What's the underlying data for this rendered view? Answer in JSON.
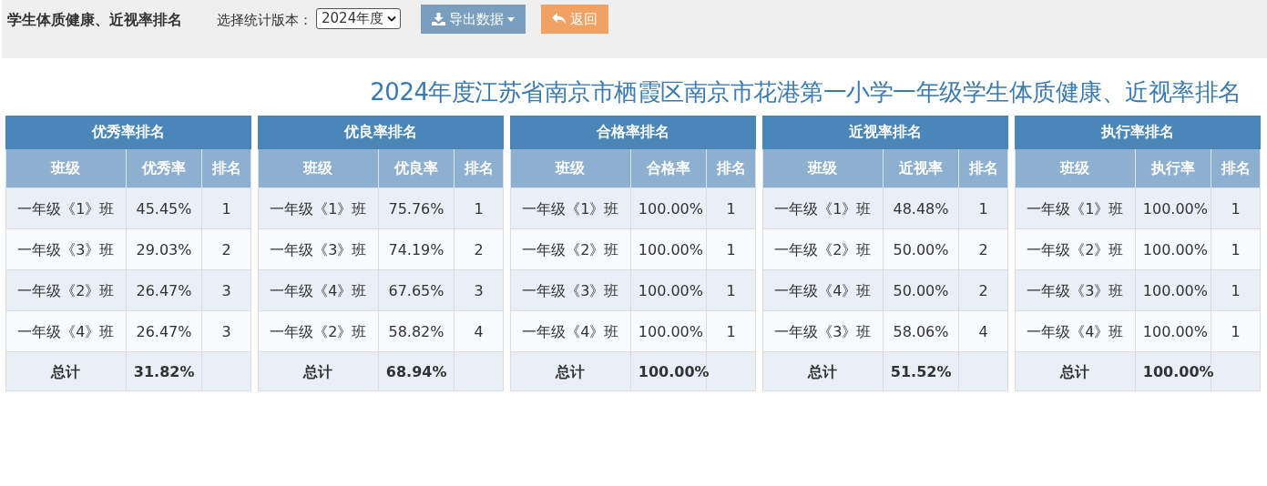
{
  "header": {
    "title": "学生体质健康、近视率排名",
    "version_label": "选择统计版本：",
    "version_select": {
      "value": "2024年度"
    },
    "buttons": [
      {
        "kind": "export",
        "label": "导出数据"
      },
      {
        "kind": "back",
        "label": "返回"
      }
    ]
  },
  "report_title": "2024年度江苏省南京市栖霞区南京市花港第一小学一年级学生体质健康、近视率排名",
  "tables": [
    {
      "title": "优秀率排名",
      "columns": [
        "班级",
        "优秀率",
        "排名"
      ],
      "rows": [
        [
          "一年级《1》班",
          "45.45%",
          "1"
        ],
        [
          "一年级《3》班",
          "29.03%",
          "2"
        ],
        [
          "一年级《2》班",
          "26.47%",
          "3"
        ],
        [
          "一年级《4》班",
          "26.47%",
          "3"
        ]
      ],
      "total": [
        "总计",
        "31.82%"
      ]
    },
    {
      "title": "优良率排名",
      "columns": [
        "班级",
        "优良率",
        "排名"
      ],
      "rows": [
        [
          "一年级《1》班",
          "75.76%",
          "1"
        ],
        [
          "一年级《3》班",
          "74.19%",
          "2"
        ],
        [
          "一年级《4》班",
          "67.65%",
          "3"
        ],
        [
          "一年级《2》班",
          "58.82%",
          "4"
        ]
      ],
      "total": [
        "总计",
        "68.94%"
      ]
    },
    {
      "title": "合格率排名",
      "columns": [
        "班级",
        "合格率",
        "排名"
      ],
      "rows": [
        [
          "一年级《1》班",
          "100.00%",
          "1"
        ],
        [
          "一年级《2》班",
          "100.00%",
          "1"
        ],
        [
          "一年级《3》班",
          "100.00%",
          "1"
        ],
        [
          "一年级《4》班",
          "100.00%",
          "1"
        ]
      ],
      "total": [
        "总计",
        "100.00%"
      ]
    },
    {
      "title": "近视率排名",
      "columns": [
        "班级",
        "近视率",
        "排名"
      ],
      "rows": [
        [
          "一年级《1》班",
          "48.48%",
          "1"
        ],
        [
          "一年级《2》班",
          "50.00%",
          "2"
        ],
        [
          "一年级《4》班",
          "50.00%",
          "2"
        ],
        [
          "一年级《3》班",
          "58.06%",
          "4"
        ]
      ],
      "total": [
        "总计",
        "51.52%"
      ]
    },
    {
      "title": "执行率排名",
      "columns": [
        "班级",
        "执行率",
        "排名"
      ],
      "rows": [
        [
          "一年级《1》班",
          "100.00%",
          "1"
        ],
        [
          "一年级《2》班",
          "100.00%",
          "1"
        ],
        [
          "一年级《3》班",
          "100.00%",
          "1"
        ],
        [
          "一年级《4》班",
          "100.00%",
          "1"
        ]
      ],
      "total": [
        "总计",
        "100.00%"
      ]
    }
  ]
}
